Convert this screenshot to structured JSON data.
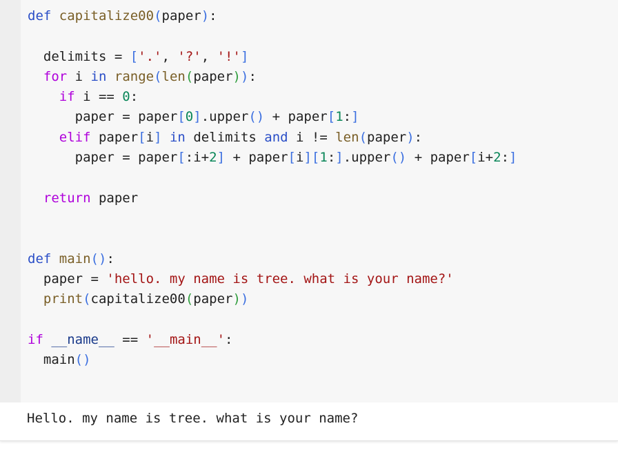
{
  "code_cell": {
    "lines": [
      [
        {
          "t": "def",
          "c": "kw-def"
        },
        {
          "t": " "
        },
        {
          "t": "capitalize00",
          "c": "fn"
        },
        {
          "t": "(",
          "c": "br"
        },
        {
          "t": "paper"
        },
        {
          "t": ")",
          "c": "br"
        },
        {
          "t": ":"
        }
      ],
      [],
      [
        {
          "t": "  delimits = "
        },
        {
          "t": "[",
          "c": "br"
        },
        {
          "t": "'.'",
          "c": "str"
        },
        {
          "t": ", "
        },
        {
          "t": "'?'",
          "c": "str"
        },
        {
          "t": ", "
        },
        {
          "t": "'!'",
          "c": "str"
        },
        {
          "t": "]",
          "c": "br"
        }
      ],
      [
        {
          "t": "  "
        },
        {
          "t": "for",
          "c": "kw-ctrl"
        },
        {
          "t": " i "
        },
        {
          "t": "in",
          "c": "kw-def"
        },
        {
          "t": " "
        },
        {
          "t": "range",
          "c": "fn"
        },
        {
          "t": "(",
          "c": "br"
        },
        {
          "t": "len",
          "c": "fn"
        },
        {
          "t": "(",
          "c": "br2"
        },
        {
          "t": "paper"
        },
        {
          "t": ")",
          "c": "br2"
        },
        {
          "t": ")",
          "c": "br"
        },
        {
          "t": ":"
        }
      ],
      [
        {
          "t": "    "
        },
        {
          "t": "if",
          "c": "kw-ctrl"
        },
        {
          "t": " i == "
        },
        {
          "t": "0",
          "c": "num"
        },
        {
          "t": ":"
        }
      ],
      [
        {
          "t": "      paper = paper"
        },
        {
          "t": "[",
          "c": "br"
        },
        {
          "t": "0",
          "c": "num"
        },
        {
          "t": "]",
          "c": "br"
        },
        {
          "t": ".upper"
        },
        {
          "t": "()",
          "c": "br"
        },
        {
          "t": " + paper"
        },
        {
          "t": "[",
          "c": "br"
        },
        {
          "t": "1",
          "c": "num"
        },
        {
          "t": ":"
        },
        {
          "t": "]",
          "c": "br"
        }
      ],
      [
        {
          "t": "    "
        },
        {
          "t": "elif",
          "c": "kw-ctrl"
        },
        {
          "t": " paper"
        },
        {
          "t": "[",
          "c": "br"
        },
        {
          "t": "i"
        },
        {
          "t": "]",
          "c": "br"
        },
        {
          "t": " "
        },
        {
          "t": "in",
          "c": "kw-def"
        },
        {
          "t": " delimits "
        },
        {
          "t": "and",
          "c": "kw-def"
        },
        {
          "t": " i != "
        },
        {
          "t": "len",
          "c": "fn"
        },
        {
          "t": "(",
          "c": "br"
        },
        {
          "t": "paper"
        },
        {
          "t": ")",
          "c": "br"
        },
        {
          "t": ":"
        }
      ],
      [
        {
          "t": "      paper = paper"
        },
        {
          "t": "[",
          "c": "br"
        },
        {
          "t": ":i+"
        },
        {
          "t": "2",
          "c": "num"
        },
        {
          "t": "]",
          "c": "br"
        },
        {
          "t": " + paper"
        },
        {
          "t": "[",
          "c": "br"
        },
        {
          "t": "i"
        },
        {
          "t": "]",
          "c": "br"
        },
        {
          "t": "[",
          "c": "br"
        },
        {
          "t": "1",
          "c": "num"
        },
        {
          "t": ":"
        },
        {
          "t": "]",
          "c": "br"
        },
        {
          "t": ".upper"
        },
        {
          "t": "()",
          "c": "br"
        },
        {
          "t": " + paper"
        },
        {
          "t": "[",
          "c": "br"
        },
        {
          "t": "i+"
        },
        {
          "t": "2",
          "c": "num"
        },
        {
          "t": ":"
        },
        {
          "t": "]",
          "c": "br"
        }
      ],
      [],
      [
        {
          "t": "  "
        },
        {
          "t": "return",
          "c": "kw-ctrl"
        },
        {
          "t": " paper"
        }
      ],
      [],
      [],
      [
        {
          "t": "def",
          "c": "kw-def"
        },
        {
          "t": " "
        },
        {
          "t": "main",
          "c": "fn"
        },
        {
          "t": "()",
          "c": "br"
        },
        {
          "t": ":"
        }
      ],
      [
        {
          "t": "  paper = "
        },
        {
          "t": "'hello. my name is tree. what is your name?'",
          "c": "str"
        }
      ],
      [
        {
          "t": "  "
        },
        {
          "t": "print",
          "c": "fn"
        },
        {
          "t": "(",
          "c": "br"
        },
        {
          "t": "capitalize00"
        },
        {
          "t": "(",
          "c": "br2"
        },
        {
          "t": "paper"
        },
        {
          "t": ")",
          "c": "br2"
        },
        {
          "t": ")",
          "c": "br"
        }
      ],
      [],
      [
        {
          "t": "if",
          "c": "kw-ctrl"
        },
        {
          "t": " "
        },
        {
          "t": "__name__",
          "c": "var"
        },
        {
          "t": " == "
        },
        {
          "t": "'__main__'",
          "c": "str"
        },
        {
          "t": ":"
        }
      ],
      [
        {
          "t": "  main"
        },
        {
          "t": "()",
          "c": "br"
        }
      ]
    ]
  },
  "output_cell": {
    "text": "Hello. my name is tree. what is your name?"
  },
  "colors": {
    "cell_background": "#f7f7f7",
    "gutter_background": "#eeeeee",
    "output_background": "#ffffff",
    "keyword_blue": "#2a4ec7",
    "keyword_control": "#af00db",
    "function": "#795e26",
    "string": "#a31515",
    "number": "#098658"
  }
}
